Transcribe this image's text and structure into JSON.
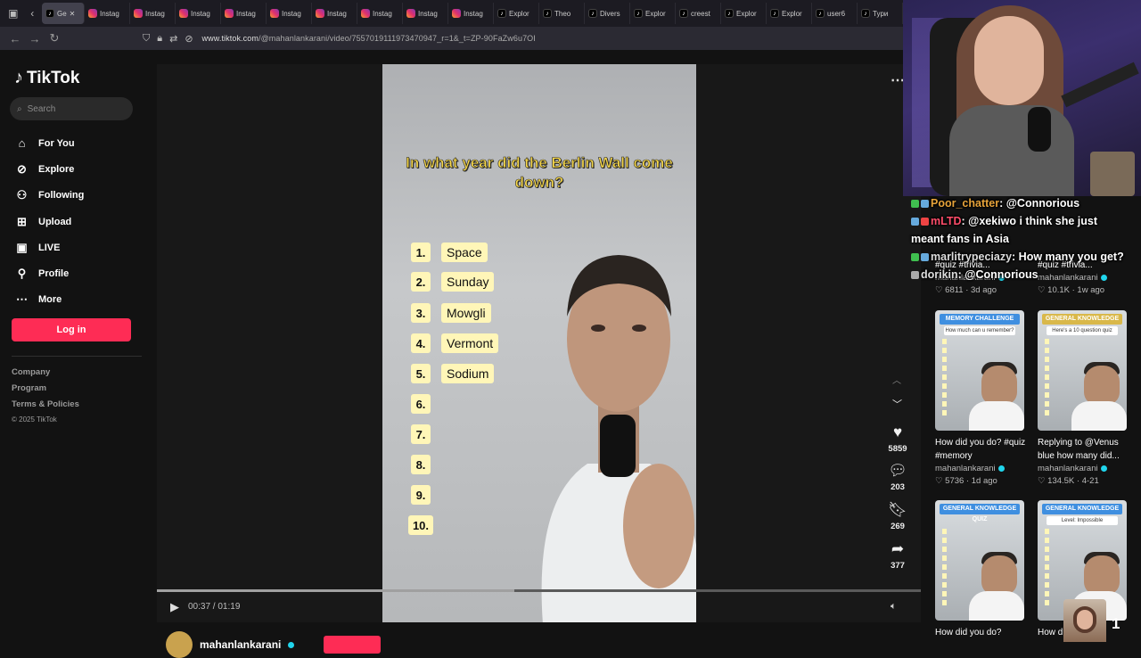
{
  "browser": {
    "tabs": [
      {
        "label": "Ge",
        "icon": "tiktok-icon",
        "active": true
      },
      {
        "label": "Instag",
        "icon": "instagram-icon"
      },
      {
        "label": "Instag",
        "icon": "instagram-icon"
      },
      {
        "label": "Instag",
        "icon": "instagram-icon"
      },
      {
        "label": "Instag",
        "icon": "instagram-icon"
      },
      {
        "label": "Instag",
        "icon": "instagram-icon"
      },
      {
        "label": "Instag",
        "icon": "instagram-icon"
      },
      {
        "label": "Instag",
        "icon": "instagram-icon"
      },
      {
        "label": "Instag",
        "icon": "instagram-icon"
      },
      {
        "label": "Instag",
        "icon": "instagram-icon"
      },
      {
        "label": "Explor",
        "icon": "tiktok-icon"
      },
      {
        "label": "Theo",
        "icon": "tiktok-icon"
      },
      {
        "label": "Divers",
        "icon": "tiktok-icon"
      },
      {
        "label": "Explor",
        "icon": "tiktok-icon"
      },
      {
        "label": "creest",
        "icon": "tiktok-icon"
      },
      {
        "label": "Explor",
        "icon": "tiktok-icon"
      },
      {
        "label": "Explor",
        "icon": "tiktok-icon"
      },
      {
        "label": "user6",
        "icon": "tiktok-icon"
      },
      {
        "label": "Typи",
        "icon": "tiktok-icon"
      }
    ],
    "url_host": "www.tiktok.com",
    "url_path": "/@mahanlankarani/video/7557019111973470947_r=1&_t=ZP-90FaZw6u7OI"
  },
  "sidebar": {
    "logo": "TikTok",
    "search_placeholder": "Search",
    "nav": [
      {
        "label": "For You",
        "icon": "home-icon"
      },
      {
        "label": "Explore",
        "icon": "compass-icon"
      },
      {
        "label": "Following",
        "icon": "following-icon"
      },
      {
        "label": "Upload",
        "icon": "upload-icon"
      },
      {
        "label": "LIVE",
        "icon": "live-icon"
      },
      {
        "label": "Profile",
        "icon": "profile-icon"
      },
      {
        "label": "More",
        "icon": "more-icon"
      }
    ],
    "login": "Log in",
    "footer": [
      "Company",
      "Program",
      "Terms & Policies"
    ],
    "copyright": "© 2025 TikTok"
  },
  "video": {
    "question": "In what year did the Berlin Wall come down?",
    "numbers": [
      "1.",
      "2.",
      "3.",
      "4.",
      "5.",
      "6.",
      "7.",
      "8.",
      "9.",
      "10."
    ],
    "answers": [
      "Space",
      "Sunday",
      "Mowgli",
      "Vermont",
      "Sodium"
    ],
    "time": "00:37 / 01:19",
    "progress": 0.468,
    "likes": "5859",
    "comments": "203",
    "saves": "269",
    "shares": "377",
    "author": "mahanlankarani"
  },
  "recommended": [
    {
      "title": "",
      "author": "mahanlankarani",
      "stats": "♡ 6811 · 3d ago",
      "badge": "",
      "sub": ""
    },
    {
      "title": "",
      "author": "mahanlankarani",
      "stats": "♡ 10.1K · 1w ago",
      "badge": "",
      "sub": ""
    },
    {
      "title": "How did you do? #quiz #memory",
      "author": "mahanlankarani",
      "stats": "♡ 5736 · 1d ago",
      "badge": "MEMORY CHALLENGE",
      "sub": "How much can u remember?",
      "badge_color": "#3f8fe0"
    },
    {
      "title": "Replying to @Venus blue how many did...",
      "author": "mahanlankarani",
      "stats": "♡ 134.5K · 4-21",
      "badge": "GENERAL KNOWLEDGE QUIZ",
      "sub": "Here's a 10 question quiz",
      "badge_color": "#d9b84a"
    },
    {
      "title": "How did you do?",
      "author": "",
      "stats": "",
      "badge": "GENERAL KNOWLEDGE QUIZ",
      "sub": "",
      "badge_color": "#3f8fe0"
    },
    {
      "title": "How d",
      "author": "",
      "stats": "",
      "badge": "GENERAL KNOWLEDGE QUIZ",
      "sub": "Level: Impossible",
      "badge_color": "#3f8fe0"
    }
  ],
  "chat": [
    {
      "user": "Poor_chatter",
      "msg": ": @Connorious"
    },
    {
      "user": "mLTD",
      "msg": ": @xekiwo i think she just"
    },
    {
      "user": "",
      "msg": "meant fans in Asia"
    },
    {
      "user": "marlitrypeciazy",
      "msg": ": How many you get?"
    },
    {
      "user": "dorikin",
      "msg": ": @Connorious"
    }
  ],
  "overlay": {
    "chat_overlap_1": "#quiz #trivia...",
    "chat_overlap_2": "#quiz #trivia...",
    "viewer_count": "1"
  }
}
